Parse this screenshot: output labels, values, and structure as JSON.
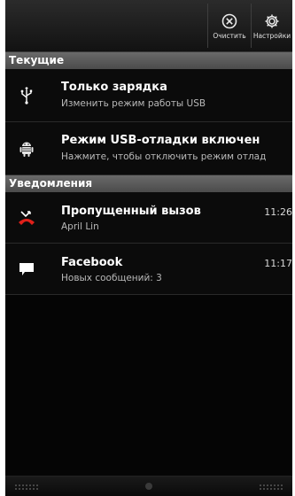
{
  "toolbar": {
    "clear_label": "Очистить",
    "settings_label": "Настройки",
    "clear_icon": "clear-x-circle-icon",
    "settings_icon": "gear-icon"
  },
  "sections": {
    "ongoing": "Текущие",
    "notifications": "Уведомления"
  },
  "ongoing_items": [
    {
      "title": "Только зарядка",
      "subtitle": "Изменить режим работы USB",
      "icon": "usb-icon"
    },
    {
      "title": "Режим USB-отладки включен",
      "subtitle": "Нажмите, чтобы отключить режим отлад",
      "icon": "android-debug-icon"
    }
  ],
  "notification_items": [
    {
      "title": "Пропущенный вызов",
      "subtitle": "April Lin",
      "time": "11:26",
      "icon": "missed-call-icon"
    },
    {
      "title": "Facebook",
      "subtitle": "Новых сообщений: 3",
      "time": "11:17",
      "icon": "message-icon"
    }
  ],
  "colors": {
    "missed_call": "#e0201a",
    "background": "#050505"
  }
}
